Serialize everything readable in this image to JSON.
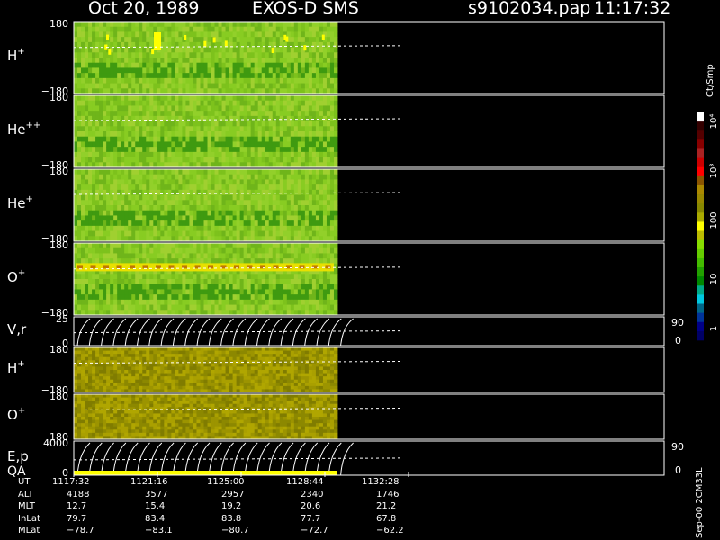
{
  "header": {
    "date": "Oct 20, 1989",
    "instrument": "EXOS-D SMS",
    "file": "s9102034.pap",
    "time": "11:17:32"
  },
  "colorbar": {
    "label": "Ct/Smp",
    "tick_labels": [
      "1",
      "10",
      "100",
      "10³",
      "10⁴"
    ],
    "colors": [
      "#000088",
      "#00a8d8",
      "#008800",
      "#22b000",
      "#55cc00",
      "#88dd00",
      "#aacc00",
      "#ffff00",
      "#8a8a00",
      "#aa9900",
      "#8b0000",
      "#cc0000",
      "#ff0000",
      "#880000",
      "#aa2222",
      "#550000",
      "#ffffff"
    ]
  },
  "footer_side_label": "Sep-00 2CM33L",
  "chart_data": {
    "type": "heatmap",
    "panels": [
      {
        "label": "H",
        "sup": "+",
        "ytop": "180",
        "ybot": "−180",
        "palette": "green",
        "stripe": "dots"
      },
      {
        "label": "He",
        "sup": "++",
        "ytop": "180",
        "ybot": "−180",
        "palette": "green"
      },
      {
        "label": "He",
        "sup": "+",
        "ytop": "180",
        "ybot": "−180",
        "palette": "green"
      },
      {
        "label": "O",
        "sup": "+",
        "ytop": "180",
        "ybot": "−180",
        "palette": "green",
        "stripe": "band"
      },
      {
        "label": "V,r",
        "sup": "",
        "ytop": "25",
        "ybot": "0",
        "palette": "lines",
        "right_ticks": [
          "90",
          "0"
        ]
      },
      {
        "label": "H",
        "sup": "+",
        "ytop": "180",
        "ybot": "−180",
        "palette": "olive"
      },
      {
        "label": "O",
        "sup": "+",
        "ytop": "180",
        "ybot": "−180",
        "palette": "olive"
      },
      {
        "label": "E,p",
        "label2": "QA",
        "sup": "",
        "ytop": "4000",
        "ybot": "0",
        "palette": "lines",
        "right_ticks": [
          "90",
          "0"
        ]
      }
    ],
    "x_ticks": [
      "1117:32",
      "1121:16",
      "1125:00",
      "1128:44",
      "1132:28"
    ],
    "rows": [
      {
        "name": "UT",
        "values": [
          "1117:32",
          "1121:16",
          "1125:00",
          "1128:44",
          "1132:28"
        ]
      },
      {
        "name": "ALT",
        "values": [
          "4188",
          "3577",
          "2957",
          "2340",
          "1746"
        ]
      },
      {
        "name": "MLT",
        "values": [
          "12.7",
          "15.4",
          "19.2",
          "20.6",
          "21.2"
        ]
      },
      {
        "name": "InLat",
        "values": [
          "79.7",
          "83.4",
          "83.8",
          "77.7",
          "67.8"
        ]
      },
      {
        "name": "MLat",
        "values": [
          "−78.7",
          "−83.1",
          "−80.7",
          "−72.7",
          "−62.2"
        ]
      }
    ]
  }
}
